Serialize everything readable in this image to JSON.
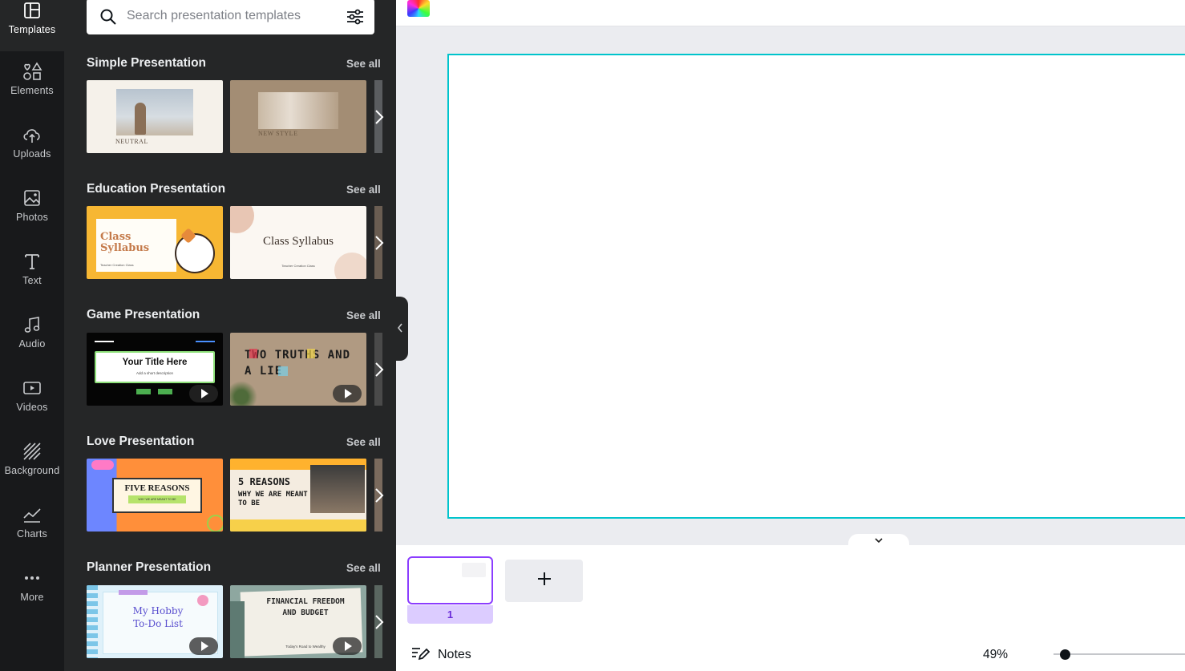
{
  "rail": {
    "items": [
      {
        "label": "Templates",
        "icon": "templates-icon",
        "active": true
      },
      {
        "label": "Elements",
        "icon": "elements-icon"
      },
      {
        "label": "Uploads",
        "icon": "uploads-icon"
      },
      {
        "label": "Photos",
        "icon": "photos-icon"
      },
      {
        "label": "Text",
        "icon": "text-icon"
      },
      {
        "label": "Audio",
        "icon": "audio-icon"
      },
      {
        "label": "Videos",
        "icon": "videos-icon"
      },
      {
        "label": "Background",
        "icon": "background-icon"
      },
      {
        "label": "Charts",
        "icon": "charts-icon"
      },
      {
        "label": "More",
        "icon": "more-icon"
      }
    ]
  },
  "search": {
    "placeholder": "Search presentation templates"
  },
  "sections": [
    {
      "title": "Simple Presentation",
      "see_all": "See all",
      "thumbs": [
        {
          "title": "NEUTRAL",
          "style": "neutral"
        },
        {
          "title": "NEW STYLE",
          "style": "newstyle"
        }
      ]
    },
    {
      "title": "Education Presentation",
      "see_all": "See all",
      "thumbs": [
        {
          "title": "Class Syllabus",
          "sub": "Teacher Creation Class",
          "style": "cat"
        },
        {
          "title": "Class Syllabus",
          "sub": "Teacher Creation Class",
          "style": "syllabus"
        }
      ]
    },
    {
      "title": "Game Presentation",
      "see_all": "See all",
      "thumbs": [
        {
          "title": "Your Title Here",
          "sub": "Add a short description",
          "style": "game"
        },
        {
          "title": "TWO TRUTHS AND A LIE",
          "style": "truths"
        }
      ]
    },
    {
      "title": "Love Presentation",
      "see_all": "See all",
      "thumbs": [
        {
          "title": "FIVE REASONS",
          "sub": "WHY WE ARE MEANT TO BE",
          "style": "fivereasons"
        },
        {
          "title": "5 REASONS",
          "sub": "WHY WE ARE MEANT TO BE",
          "style": "collage"
        }
      ]
    },
    {
      "title": "Planner Presentation",
      "see_all": "See all",
      "thumbs": [
        {
          "title": "My Hobby To-Do List",
          "style": "hobby"
        },
        {
          "title": "FINANCIAL FREEDOM AND BUDGET",
          "sub": "Today's Road to Wealthy",
          "style": "financial"
        }
      ]
    }
  ],
  "pages": {
    "current": "1"
  },
  "footer": {
    "notes_label": "Notes",
    "zoom": "49%"
  }
}
